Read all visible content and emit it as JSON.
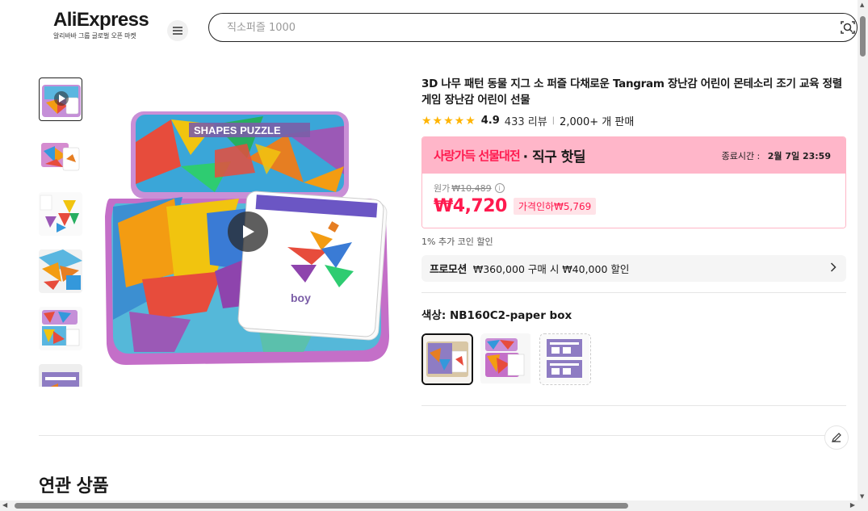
{
  "header": {
    "logo_text": "AliExpress",
    "logo_sub": "알리바바 그룹 글로벌 오픈 마켓",
    "search_placeholder": "직소퍼즐 1000"
  },
  "product": {
    "title": "3D 나무 패턴 동물 지그 소 퍼즐 다채로운 Tangram 장난감 어린이 몬테소리 조기 교육 정렬 게임 장난감 어린이 선물",
    "rating": "4.9",
    "rating_stars": 5,
    "reviews": "433 리뷰",
    "sold": "2,000+ 개 판매",
    "deal": {
      "brand": "사랑가득 선물대전",
      "name": "직구 핫딜",
      "time_label": "종료시간 :",
      "time_value": "2월 7일 23:59"
    },
    "original_label": "원가",
    "original_price": "₩10,489",
    "price": "₩4,720",
    "discount": "가격인하₩5,769",
    "coin_note": "1% 추가 코인 할인",
    "promo_label": "프로모션",
    "promo_text": "₩360,000 구매 시 ₩40,000 할인",
    "color_label": "색상: NB160C2-paper box"
  },
  "image_text": {
    "tin_label": "SHAPES PUZZLE",
    "card_word": "boy"
  },
  "colors": {
    "accent": "#ff1a4f",
    "deal_band": "#ffb6c9",
    "star": "#ffb400"
  },
  "related_title": "연관 상품"
}
